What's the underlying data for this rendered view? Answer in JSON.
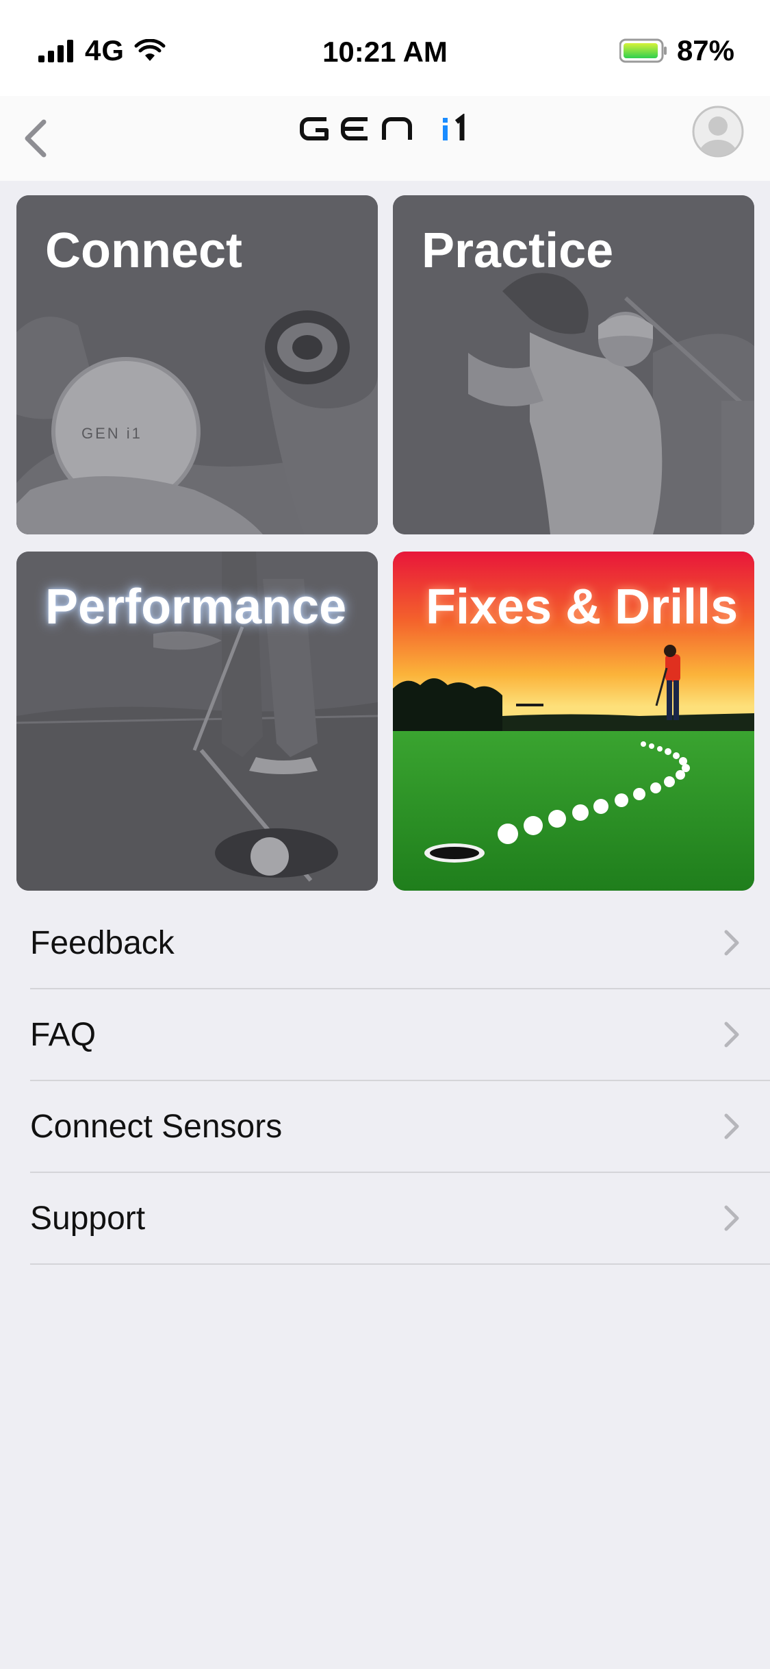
{
  "status_bar": {
    "carrier": "4G",
    "time": "10:21 AM",
    "battery": "87%"
  },
  "nav": {
    "logo_text": "GEN",
    "logo_accent": "i1",
    "accent_color": "#1a8cff"
  },
  "tiles": [
    {
      "label": "Connect"
    },
    {
      "label": "Practice"
    },
    {
      "label": "Performance"
    },
    {
      "label": "Fixes & Drills"
    }
  ],
  "menu": [
    {
      "label": "Feedback"
    },
    {
      "label": "FAQ"
    },
    {
      "label": "Connect Sensors"
    },
    {
      "label": "Support"
    }
  ],
  "icons": {
    "back": "chevron-left-icon",
    "avatar": "user-avatar-icon",
    "menu_chevron": "chevron-right-icon"
  }
}
